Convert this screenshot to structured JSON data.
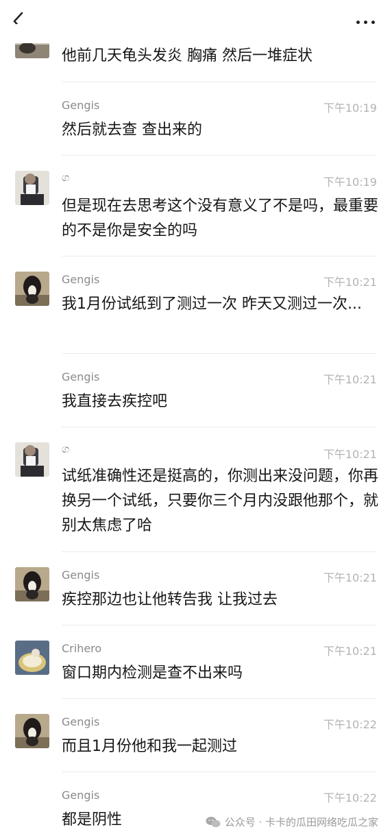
{
  "nav": {
    "back_icon": "chevron-left-icon",
    "more_icon": "more-horizontal-icon"
  },
  "messages": [
    {
      "sender": "",
      "time": "",
      "text": "他前几天龟头发炎 胸痛 然后一堆症状"
    },
    {
      "sender": "Gengis",
      "time": "下午10:19",
      "text": "然后就去查 查出来的"
    },
    {
      "sender": "ග",
      "time": "下午10:19",
      "text": "但是现在去思考这个没有意义了不是吗，最重要的不是你是安全的吗"
    },
    {
      "sender": "Gengis",
      "time": "下午10:21",
      "text": "我1月份试纸到了测过一次 昨天又测过一次..."
    },
    {
      "sender": "Gengis",
      "time": "下午10:21",
      "text": "我直接去疾控吧"
    },
    {
      "sender": "ග",
      "time": "下午10:21",
      "text": "试纸准确性还是挺高的，你测出来没问题，你再换另一个试纸，只要你三个月内没跟他那个，就别太焦虑了哈"
    },
    {
      "sender": "Gengis",
      "time": "下午10:21",
      "text": "疾控那边也让他转告我 让我过去"
    },
    {
      "sender": "Crihero",
      "time": "下午10:21",
      "text": "窗口期内检测是查不出来吗"
    },
    {
      "sender": "Gengis",
      "time": "下午10:22",
      "text": "而且1月份他和我一起测过"
    },
    {
      "sender": "Gengis",
      "time": "下午10:22",
      "text": "都是阴性"
    }
  ],
  "watermark": {
    "icon": "wechat-icon",
    "text": "公众号 · 卡卡的瓜田网络吃瓜之家"
  },
  "colors": {
    "background": "#ffffff",
    "sender": "#8a8a8a",
    "time": "#b3b3b3",
    "text": "#161616",
    "divider": "#ececec"
  }
}
